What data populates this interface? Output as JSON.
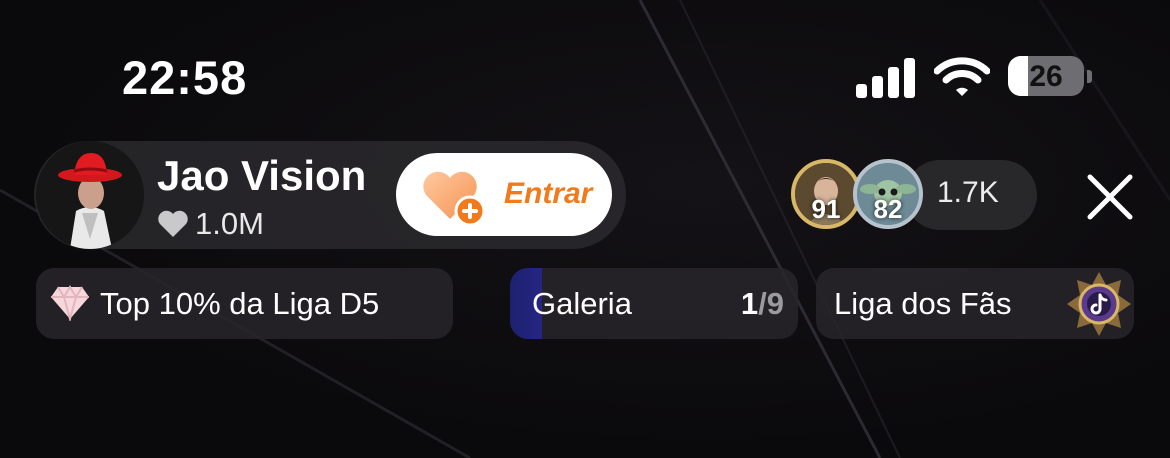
{
  "status_bar": {
    "time": "22:58",
    "battery_level": "26",
    "battery_fraction": 0.26,
    "icons": [
      "cellular-signal-icon",
      "wifi-icon",
      "battery-icon"
    ]
  },
  "host": {
    "name": "Jao Vision",
    "likes": "1.0M",
    "avatar_icon": "avatar-red-cowboy-hat",
    "follow_label": "Entrar",
    "follow_icon": "heart-plus-icon"
  },
  "viewers": {
    "top": [
      {
        "rank": "91",
        "ring_color": "#d8b867"
      },
      {
        "rank": "82",
        "ring_color": "#b7c3cc"
      }
    ],
    "count": "1.7K"
  },
  "chips": {
    "league": {
      "label": "Top 10% da Liga D5",
      "icon": "diamond-icon"
    },
    "gallery": {
      "label": "Galeria",
      "current": "1",
      "separator": "/",
      "total": "9",
      "progress": 0.111
    },
    "fans": {
      "label": "Liga dos Fãs",
      "icon": "fan-league-badge-icon"
    }
  },
  "colors": {
    "follow_accent": "#f07a1c",
    "gallery_progress": "#242682",
    "pill_background": "#2d2b2f"
  }
}
